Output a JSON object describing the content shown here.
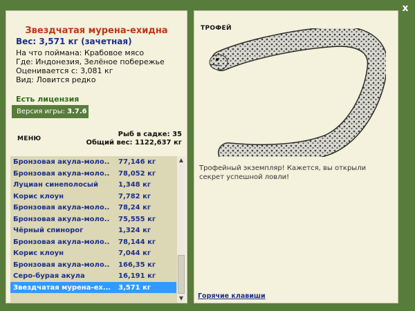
{
  "close_label": "x",
  "fish": {
    "name": "Звездчатая мурена-ехидна",
    "weight": "Вес: 3,571 кг (зачетная)",
    "bait": "На что поймана: Крабовое мясо",
    "where": "Где: Индонезия, Зелёное побережье",
    "value": "Оценивается с: 3,081 кг",
    "kind": "Вид: Ловится редко"
  },
  "license": "Есть лицензия",
  "version": {
    "label": "Версия игры:",
    "number": "3.7.6"
  },
  "menu_label": "МЕНЮ",
  "cage": {
    "count": "Рыб в садке: 35",
    "total": "Общий вес: 1122,637 кг"
  },
  "catch_list": [
    {
      "name": "Бронзовая акула-моло...",
      "weight": "77,146 кг"
    },
    {
      "name": "Бронзовая акула-моло...",
      "weight": "78,052 кг"
    },
    {
      "name": "Луциан синеполосый",
      "weight": "1,348 кг"
    },
    {
      "name": "Корис клоун",
      "weight": "7,782 кг"
    },
    {
      "name": "Бронзовая акула-моло...",
      "weight": "78,24 кг"
    },
    {
      "name": "Бронзовая акула-моло...",
      "weight": "75,555 кг"
    },
    {
      "name": "Чёрный спинорог",
      "weight": "1,324 кг"
    },
    {
      "name": "Бронзовая акула-моло...",
      "weight": "78,144 кг"
    },
    {
      "name": "Корис клоун",
      "weight": "7,044 кг"
    },
    {
      "name": "Бронзовая акула-моло...",
      "weight": "166,35 кг"
    },
    {
      "name": "Серо-бурая акула",
      "weight": "16,191 кг"
    },
    {
      "name": "Звездчатая мурена-ех...",
      "weight": "3,571 кг",
      "selected": true
    }
  ],
  "trophy": {
    "label": "ТРОФЕЙ",
    "text": "Трофейный экземпляр! Кажется, вы открыли секрет успешной ловли!"
  },
  "hotkeys_label": "Горячие клавиши",
  "colors": {
    "frame": "#587c3c",
    "panel": "#f4f1dc",
    "title": "#c0351b",
    "link": "#1d2f8a",
    "selected": "#3399ff",
    "license": "#2e6f1d"
  }
}
